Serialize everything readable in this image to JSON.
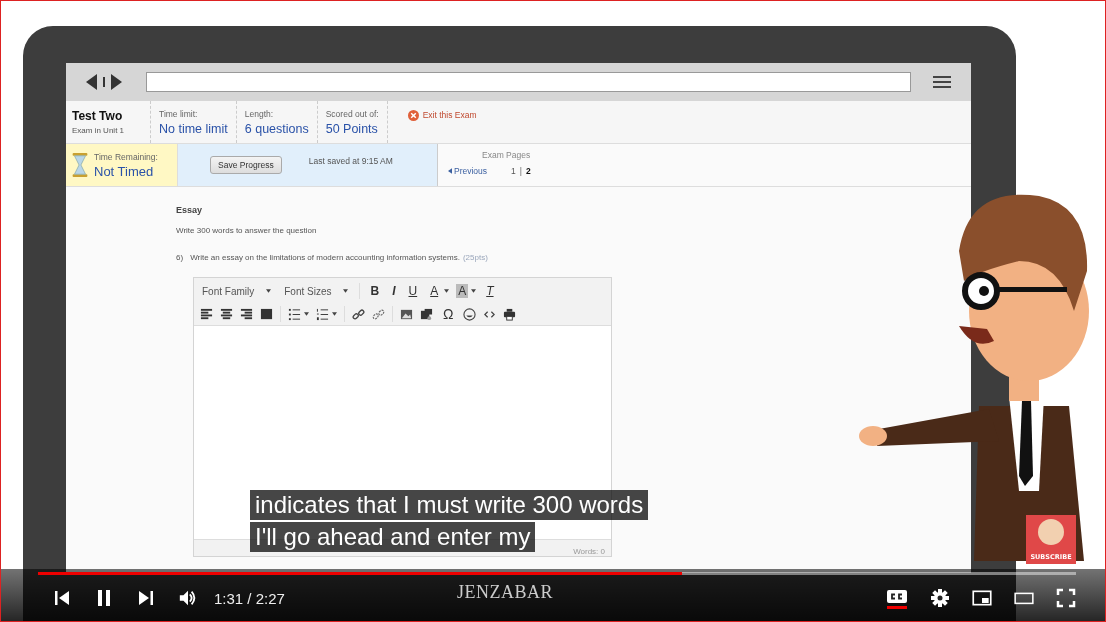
{
  "exam": {
    "title": "Test Two",
    "subtitle": "Exam in Unit 1",
    "facts": [
      {
        "label": "Time limit:",
        "value": "No time limit"
      },
      {
        "label": "Length:",
        "value": "6 questions"
      },
      {
        "label": "Scored out of:",
        "value": "50 Points"
      }
    ],
    "exit": "Exit this Exam"
  },
  "status": {
    "remaining_label": "Time Remaining:",
    "remaining": "Not Timed",
    "save_button": "Save Progress",
    "last_saved": "Last saved at 9:15 AM",
    "pages_label": "Exam Pages",
    "previous": "Previous",
    "page_separator": "|",
    "pages": [
      {
        "label": "1",
        "selected": false
      },
      {
        "label": "2",
        "selected": true
      }
    ]
  },
  "question": {
    "section": "Essay",
    "instruction": "Write 300 words to answer the question",
    "number": "6)",
    "text": "Write an essay on the limitations of modern accounting information systems.",
    "points": "(25pts)"
  },
  "editor": {
    "toolbar_rows": [
      [
        {
          "kind": "dropdown",
          "label": "Font Family"
        },
        {
          "kind": "dropdown",
          "label": "Font Sizes"
        },
        {
          "kind": "separator"
        },
        {
          "kind": "bold",
          "label": "B"
        },
        {
          "kind": "italic",
          "label": "I"
        },
        {
          "kind": "underline",
          "label": "U"
        },
        {
          "kind": "text-color",
          "label": "A"
        },
        {
          "kind": "background-color",
          "label": "A"
        },
        {
          "kind": "clear-format",
          "label": "T"
        }
      ],
      [
        {
          "kind": "align-left"
        },
        {
          "kind": "align-center"
        },
        {
          "kind": "align-right"
        },
        {
          "kind": "justify"
        },
        {
          "kind": "separator"
        },
        {
          "kind": "bullet-list"
        },
        {
          "kind": "numbered-list"
        },
        {
          "kind": "separator"
        },
        {
          "kind": "link"
        },
        {
          "kind": "unlink"
        },
        {
          "kind": "separator"
        },
        {
          "kind": "image"
        },
        {
          "kind": "media"
        },
        {
          "kind": "symbol",
          "label": "Ω"
        },
        {
          "kind": "emoji"
        },
        {
          "kind": "code"
        },
        {
          "kind": "print"
        }
      ]
    ],
    "word_count": "Words: 0"
  },
  "player": {
    "captions": [
      "indicates that I must write 300 words",
      "I'll go ahead and enter my"
    ],
    "progress": {
      "level": 0.62
    },
    "time": "1:31 / 2:27",
    "captions_on": true,
    "watermark": "JENZABAR",
    "subscribe": "SUBSCRIBE"
  }
}
